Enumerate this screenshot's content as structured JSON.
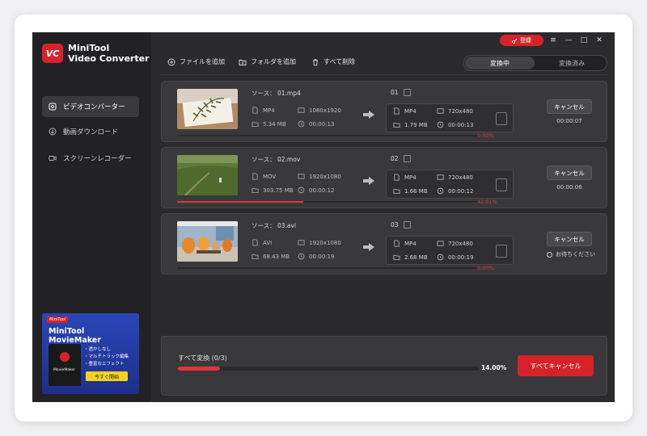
{
  "app": {
    "brand_line1": "MiniTool",
    "brand_line2": "Video Converter",
    "logo_text": "VC"
  },
  "sidebar": {
    "items": [
      {
        "label": "ビデオコンバーター",
        "icon": "convert-icon",
        "active": true
      },
      {
        "label": "動画ダウンロード",
        "icon": "download-icon",
        "active": false
      },
      {
        "label": "スクリーンレコーダー",
        "icon": "camera-icon",
        "active": false
      }
    ]
  },
  "promo": {
    "badge": "MiniTool",
    "title": "MiniTool MovieMaker",
    "box_label": "MovieMaker",
    "features": [
      "・透かしなし",
      "・マルチトラック編集",
      "・豊富なエフェクト"
    ],
    "cta": "今すぐ開始"
  },
  "titlebar": {
    "login": "登録",
    "menu": "≡",
    "minimize": "—",
    "maximize": "□",
    "close": "✕"
  },
  "toolbar": {
    "add_file": "ファイルを追加",
    "add_folder": "フォルダを追加",
    "delete_all": "すべて削除"
  },
  "tabs": {
    "converting": "変換中",
    "converted": "変換済み"
  },
  "colors": {
    "accent": "#d6232a",
    "progress": "#e0353d"
  },
  "tasks": [
    {
      "source": "ソース：  01.mp4",
      "out_name": "01",
      "src_format": "MP4",
      "src_res": "1080x1920",
      "src_size": "5.34 MB",
      "src_dur": "00:00:13",
      "out_format": "MP4",
      "out_res": "720x480",
      "out_size": "1.79 MB",
      "out_dur": "00:00:13",
      "progress_label": "0.00%",
      "progress": 0.0,
      "cancel": "キャンセル",
      "time": "00:00:07"
    },
    {
      "source": "ソース：  02.mov",
      "out_name": "02",
      "src_format": "MOV",
      "src_res": "1920x1080",
      "src_size": "303.75 MB",
      "src_dur": "00:00:12",
      "out_format": "MP4",
      "out_res": "720x480",
      "out_size": "1.66 MB",
      "out_dur": "00:00:12",
      "progress_label": "42.01%",
      "progress": 0.4201,
      "cancel": "キャンセル",
      "time": "00:00:06"
    },
    {
      "source": "ソース：  03.avi",
      "out_name": "03",
      "src_format": "AVI",
      "src_res": "1920x1080",
      "src_size": "68.43 MB",
      "src_dur": "00:00:19",
      "out_format": "MP4",
      "out_res": "720x480",
      "out_size": "2.68 MB",
      "out_dur": "00:00:19",
      "progress_label": "0.00%",
      "progress": 0.0,
      "cancel": "キャンセル",
      "status": "お待ちください"
    }
  ],
  "footer": {
    "label": "すべて変換 (0/3)",
    "percent_label": "14.00%",
    "percent": 0.14,
    "cancel_all": "すべてキャンセル"
  }
}
